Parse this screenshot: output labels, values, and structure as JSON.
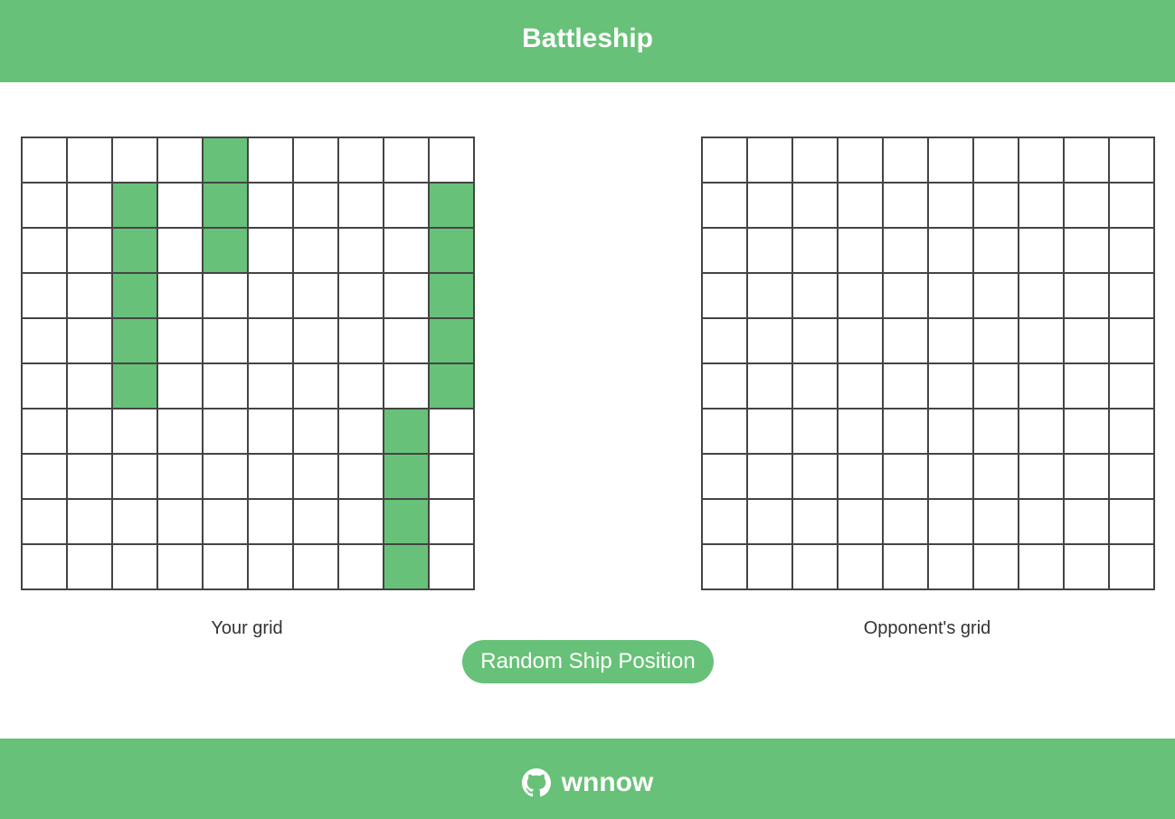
{
  "header": {
    "title": "Battleship"
  },
  "your_grid": {
    "label": "Your grid",
    "rows": 10,
    "cols": 10,
    "ship_cells": [
      [
        0,
        4
      ],
      [
        1,
        4
      ],
      [
        2,
        4
      ],
      [
        1,
        2
      ],
      [
        2,
        2
      ],
      [
        3,
        2
      ],
      [
        4,
        2
      ],
      [
        5,
        2
      ],
      [
        1,
        9
      ],
      [
        2,
        9
      ],
      [
        3,
        9
      ],
      [
        4,
        9
      ],
      [
        5,
        9
      ],
      [
        6,
        8
      ],
      [
        7,
        8
      ],
      [
        8,
        8
      ],
      [
        9,
        8
      ]
    ]
  },
  "opponent_grid": {
    "label": "Opponent's grid",
    "rows": 10,
    "cols": 10,
    "ship_cells": []
  },
  "controls": {
    "random_label": "Random Ship Position"
  },
  "footer": {
    "icon": "github-icon",
    "username": "wnnow"
  },
  "colors": {
    "brand": "#68c178",
    "grid_line": "#444444"
  }
}
